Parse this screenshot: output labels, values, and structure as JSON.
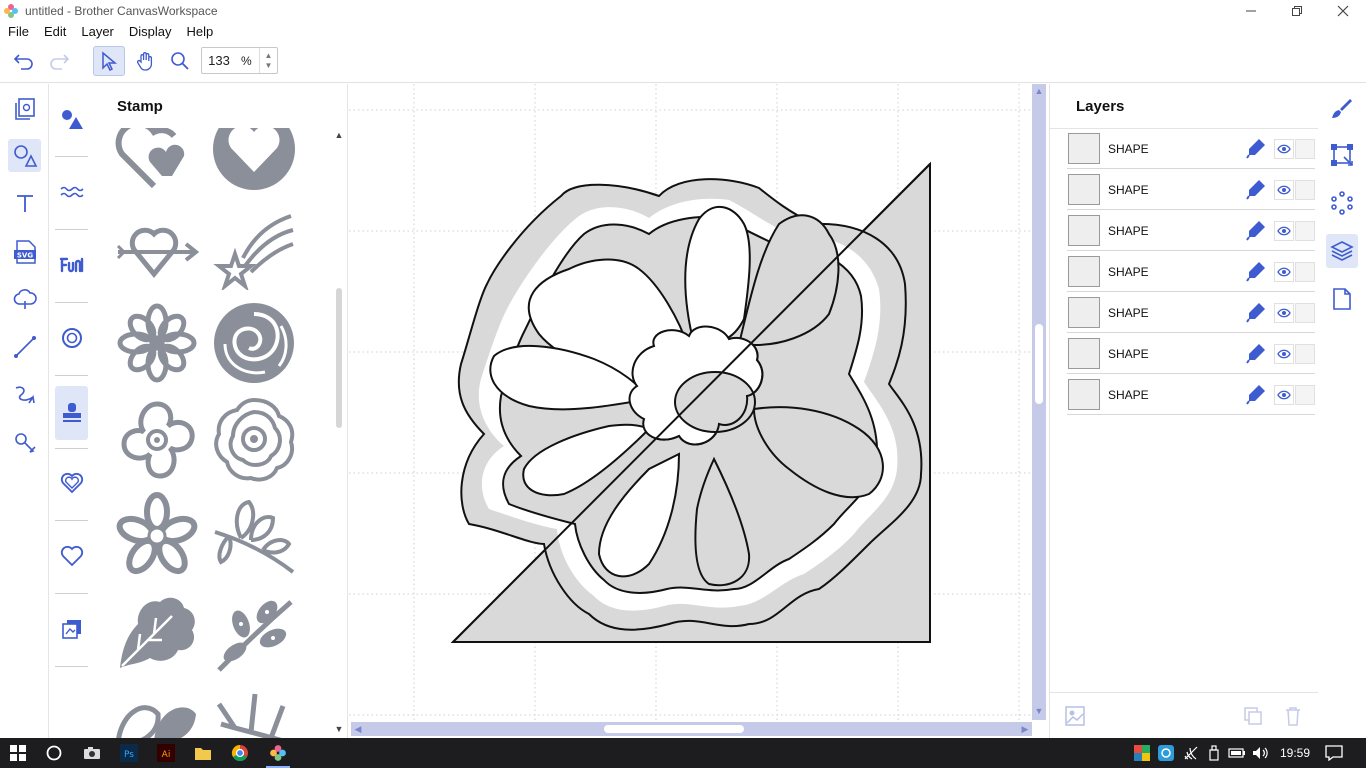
{
  "window": {
    "title": "untitled - Brother CanvasWorkspace",
    "app_icon": "canvasworkspace-logo-icon",
    "controls": [
      "minimize-icon",
      "restore-icon",
      "close-icon"
    ]
  },
  "menu": {
    "items": [
      "File",
      "Edit",
      "Layer",
      "Display",
      "Help"
    ]
  },
  "toolbar": {
    "zoom_value": "133",
    "zoom_unit": "%",
    "tools": [
      "undo-icon",
      "redo-icon",
      "select-arrow-icon",
      "hand-pan-icon",
      "zoom-magnifier-icon"
    ]
  },
  "left_rail": {
    "items": [
      "project-icon",
      "shapes-icon",
      "text-icon",
      "svg-icon",
      "cloud-icon",
      "line-icon",
      "freehand-icon",
      "magic-wand-icon"
    ],
    "active": "shapes-icon"
  },
  "categories": {
    "items": [
      "basic-shapes-icon",
      "wave-icon",
      "fun-text-icon",
      "lifebuoy-icon",
      "stamp-icon",
      "heart-outline-icon",
      "heart-icon",
      "copy-shapes-icon"
    ],
    "active": "stamp-icon"
  },
  "stamp_panel": {
    "title": "Stamp"
  },
  "layers": {
    "title": "Layers",
    "rows": [
      {
        "label": "SHAPE"
      },
      {
        "label": "SHAPE"
      },
      {
        "label": "SHAPE"
      },
      {
        "label": "SHAPE"
      },
      {
        "label": "SHAPE"
      },
      {
        "label": "SHAPE"
      },
      {
        "label": "SHAPE"
      }
    ]
  },
  "right_rail": {
    "items": [
      "brush-icon",
      "transform-box-icon",
      "node-edit-icon",
      "layers-icon",
      "page-icon"
    ],
    "active": "layers-icon"
  },
  "taskbar": {
    "clock": "19:59"
  },
  "colors": {
    "accent": "#3f5bd0",
    "active_bg": "#dfe6f7",
    "scroll": "#c5cae9",
    "stamp_gray": "#8a8f99",
    "shape_fill": "#d9d9d9"
  }
}
